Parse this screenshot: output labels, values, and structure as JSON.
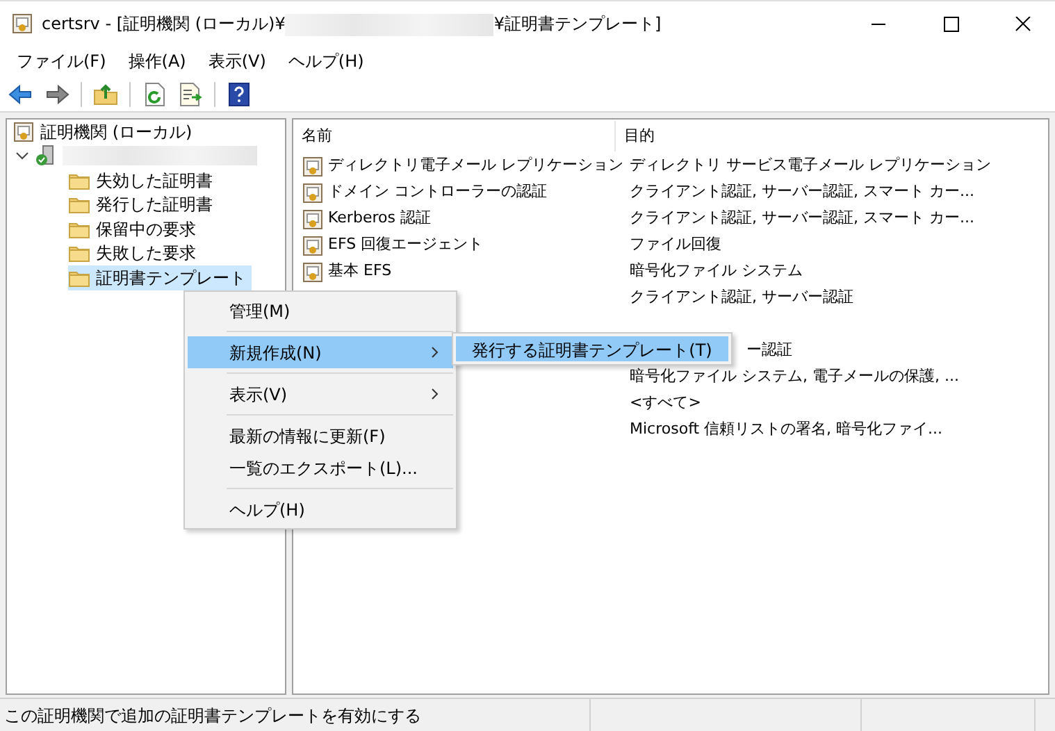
{
  "window": {
    "title_start": "certsrv - [証明機関 (ローカル)¥",
    "title_end": "¥証明書テンプレート]"
  },
  "menu_bar": [
    "ファイル(F)",
    "操作(A)",
    "表示(V)",
    "ヘルプ(H)"
  ],
  "toolbar": [
    {
      "kind": "back",
      "disabled": false
    },
    {
      "kind": "forward",
      "disabled": true
    },
    {
      "kind": "up",
      "disabled": false
    },
    {
      "kind": "refresh",
      "disabled": false
    },
    {
      "kind": "export",
      "disabled": false
    },
    {
      "kind": "help",
      "disabled": false
    }
  ],
  "tree": {
    "label": "証明機関 (ローカル)",
    "children": [
      {
        "expanded": true,
        "children": [
          {
            "label": "失効した証明書",
            "selected": false
          },
          {
            "label": "発行した証明書",
            "selected": false
          },
          {
            "label": "保留中の要求",
            "selected": false
          },
          {
            "label": "失敗した要求",
            "selected": false
          },
          {
            "label": "証明書テンプレート",
            "selected": true
          }
        ]
      }
    ]
  },
  "list": {
    "columns": [
      "名前",
      "目的"
    ],
    "rows": [
      {
        "name": "ディレクトリ電子メール レプリケーション",
        "purpose": "ディレクトリ サービス電子メール レプリケーション"
      },
      {
        "name": "ドメイン コントローラーの認証",
        "purpose": "クライアント認証, サーバー認証, スマート カー..."
      },
      {
        "name": "Kerberos 認証",
        "purpose": "クライアント認証, サーバー認証, スマート カー..."
      },
      {
        "name": "EFS 回復エージェント",
        "purpose": "ファイル回復"
      },
      {
        "name": "基本 EFS",
        "purpose": "暗号化ファイル システム"
      },
      {
        "purpose": "クライアント認証, サーバー認証"
      },
      {},
      {
        "purpose": "ー認証",
        "kind": "covered"
      },
      {
        "purpose": "暗号化ファイル システム, 電子メールの保護, ..."
      },
      {
        "purpose": "<すべて>"
      },
      {
        "purpose": "Microsoft 信頼リストの署名, 暗号化ファイ..."
      }
    ]
  },
  "context_menu": {
    "items": [
      {
        "kind": "item",
        "label": "管理(M)",
        "selected": false,
        "submenu": false
      },
      {
        "kind": "separator"
      },
      {
        "kind": "item",
        "label": "新規作成(N)",
        "selected": true,
        "submenu": true
      },
      {
        "kind": "separator"
      },
      {
        "kind": "item",
        "label": "表示(V)",
        "selected": false,
        "submenu": true
      },
      {
        "kind": "separator"
      },
      {
        "kind": "item",
        "label": "最新の情報に更新(F)",
        "selected": false,
        "submenu": false
      },
      {
        "kind": "item",
        "label": "一覧のエクスポート(L)...",
        "selected": false,
        "submenu": false
      },
      {
        "kind": "separator"
      },
      {
        "kind": "item",
        "label": "ヘルプ(H)",
        "selected": false,
        "submenu": false
      }
    ]
  },
  "submenu": {
    "items": [
      {
        "label": "発行する証明書テンプレート(T)",
        "selected": true
      }
    ]
  },
  "status_bar": {
    "text": "この証明機関で追加の証明書テンプレートを有効にする"
  }
}
